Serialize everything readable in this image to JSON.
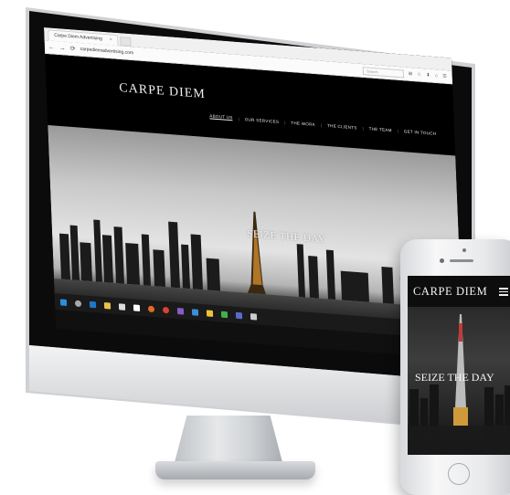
{
  "browser": {
    "tab_title": "Carpe Diem Advertising",
    "tab_close": "×",
    "url": "carpediemadvertising.com",
    "search_placeholder": "Search",
    "back": "←",
    "forward": "→",
    "reload": "⟳",
    "toolbar_icons": "⊞ ☆ ⬇ ⌂ ☰"
  },
  "site": {
    "logo": "CARPE DIEM",
    "nav": [
      "ABOUT US",
      "OUR SERVICES",
      "THE WORK",
      "THE CLIENTS",
      "THE TEAM",
      "GET IN TOUCH"
    ],
    "hero_title": "SEIZE THE DAY"
  },
  "mobile": {
    "logo": "CARPE DIEM",
    "hero_title": "SEIZE THE DAY"
  },
  "taskbar": {
    "icons": [
      "windows-icon",
      "search-icon",
      "edge-icon",
      "files-icon",
      "store-icon",
      "home-icon",
      "firefox-icon",
      "chrome-icon",
      "photos-icon",
      "app-icon",
      "explorer-icon",
      "media-icon",
      "tasks-icon",
      "mail-icon"
    ]
  }
}
